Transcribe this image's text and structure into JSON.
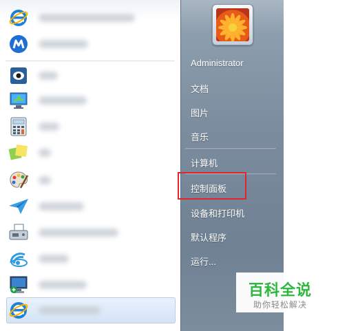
{
  "start_menu": {
    "left_pane": {
      "programs": [
        {
          "icon": "ie-icon"
        },
        {
          "icon": "maxthon-browser-icon"
        },
        {
          "icon": "media-app-icon"
        },
        {
          "icon": "remote-desktop-icon"
        },
        {
          "icon": "calculator-icon"
        },
        {
          "icon": "sticky-notes-icon"
        },
        {
          "icon": "paint-icon"
        },
        {
          "icon": "paper-plane-icon"
        },
        {
          "icon": "fax-scan-icon"
        },
        {
          "icon": "wireless-network-icon"
        },
        {
          "icon": "network-computer-icon"
        },
        {
          "icon": "ie-icon"
        }
      ]
    },
    "right_pane": {
      "user_name": "Administrator",
      "items": {
        "documents": "文档",
        "pictures": "图片",
        "music": "音乐",
        "computer": "计算机",
        "control_panel": "控制面板",
        "devices_printers": "设备和打印机",
        "default_programs": "默认程序",
        "run": "运行..."
      }
    },
    "highlight_color": "#e5232b"
  },
  "watermark": {
    "title": "百科全说",
    "subtitle": "助你轻松解决",
    "color": "#2db83d"
  }
}
